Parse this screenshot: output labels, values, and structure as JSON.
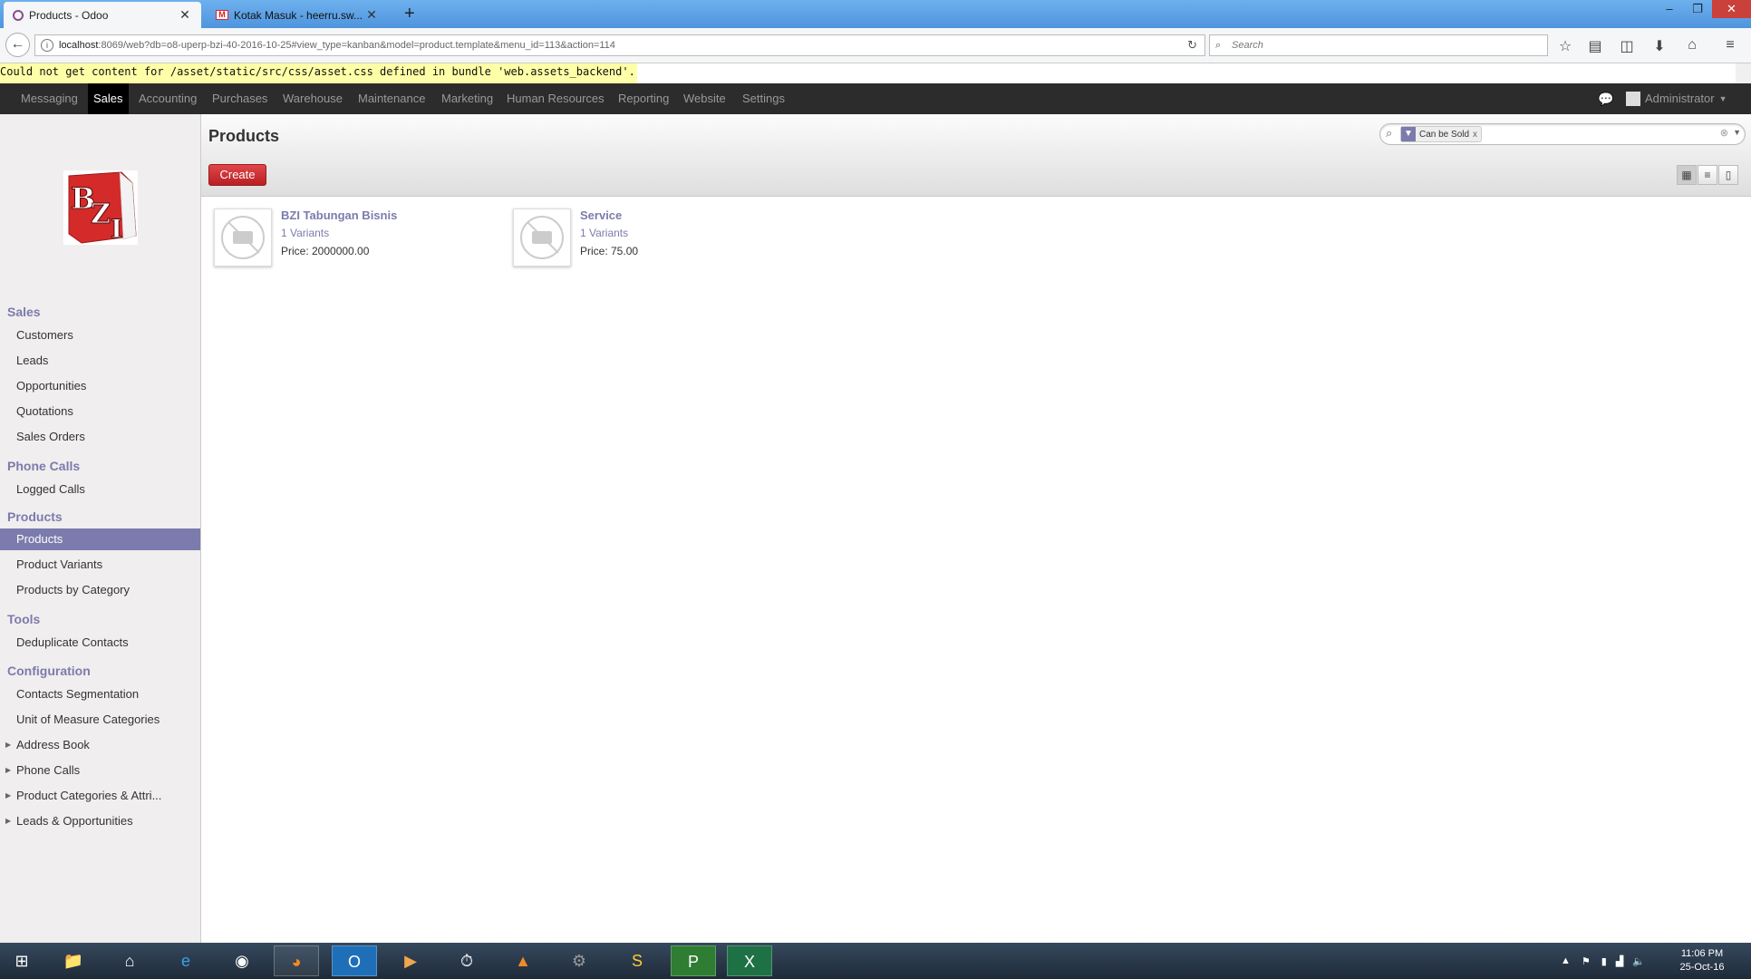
{
  "browser": {
    "tabs": [
      {
        "title": "Products - Odoo"
      },
      {
        "title": "Kotak Masuk - heerru.sw..."
      }
    ],
    "url_host": "localhost",
    "url_rest": ":8069/web?db=o8-uperp-bzi-40-2016-10-25#view_type=kanban&model=product.template&menu_id=113&action=114",
    "search_placeholder": "Search"
  },
  "error_message": "Could not get content for /asset/static/src/css/asset.css defined in bundle 'web.assets_backend'.",
  "topmenu": {
    "items": [
      "Messaging",
      "Sales",
      "Accounting",
      "Purchases",
      "Warehouse",
      "Maintenance",
      "Marketing",
      "Human Resources",
      "Reporting",
      "Website",
      "Settings"
    ],
    "active": "Sales",
    "user": "Administrator"
  },
  "sidebar": {
    "logo_text": "BZI",
    "sections": [
      {
        "title": "Sales",
        "items": [
          "Customers",
          "Leads",
          "Opportunities",
          "Quotations",
          "Sales Orders"
        ]
      },
      {
        "title": "Phone Calls",
        "items": [
          "Logged Calls"
        ]
      },
      {
        "title": "Products",
        "items": [
          "Products",
          "Product Variants",
          "Products by Category"
        ]
      },
      {
        "title": "Tools",
        "items": [
          "Deduplicate Contacts"
        ]
      },
      {
        "title": "Configuration",
        "items": [
          "Contacts Segmentation",
          "Unit of Measure Categories",
          "Address Book",
          "Phone Calls",
          "Product Categories & Attri...",
          "Leads & Opportunities"
        ]
      }
    ],
    "active_item": "Products"
  },
  "main": {
    "title": "Products",
    "create_label": "Create",
    "search_facet": "Can be Sold",
    "products": [
      {
        "name": "BZI Tabungan Bisnis",
        "variants": "1 Variants",
        "price": "Price: 2000000.00"
      },
      {
        "name": "Service",
        "variants": "1 Variants",
        "price": "Price: 75.00"
      }
    ]
  },
  "taskbar": {
    "time": "11:06 PM",
    "date": "25-Oct-16"
  },
  "colors": {
    "odoo_accent": "#7c7bad",
    "create_button": "#d23c3c",
    "topbar": "#2c2c2c"
  }
}
